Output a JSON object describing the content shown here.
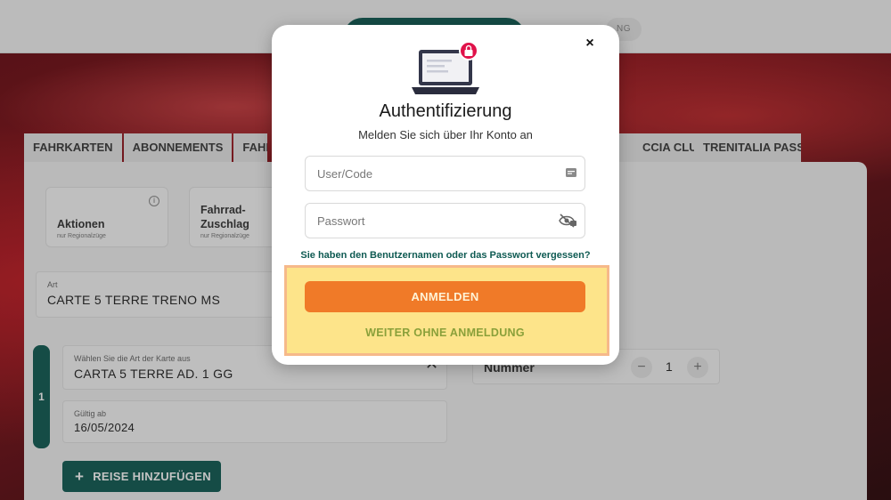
{
  "topbar": {
    "language_label": "NG"
  },
  "tabs": [
    "FAHRKARTEN",
    "ABONNEMENTS",
    "FAHR",
    "",
    "",
    "",
    "CCIA CLUB",
    "TRENITALIA PASS"
  ],
  "promos": [
    {
      "title": "Aktionen",
      "subtitle": "nur Regionalzüge",
      "info": "i"
    },
    {
      "title_line1": "Fahrrad-",
      "title_line2": "Zuschlag",
      "subtitle": "nur Regionalzüge"
    }
  ],
  "art_field": {
    "label": "Art",
    "value": "CARTE 5 TERRE TRENO MS"
  },
  "trip": {
    "index": "1",
    "card_type": {
      "label": "Wählen Sie die Art der Karte aus",
      "value": "CARTA 5 TERRE AD. 1 GG"
    },
    "valid_from": {
      "label": "Gültig ab",
      "value": "16/05/2024"
    },
    "number": {
      "label": "Nummer",
      "value": "1",
      "minus": "−",
      "plus": "+"
    }
  },
  "add_trip": {
    "icon": "+",
    "label": "REISE HINZUFÜGEN"
  },
  "modal": {
    "close": "×",
    "title": "Authentifizierung",
    "subtitle": "Melden Sie sich über Ihr Konto an",
    "user_placeholder": "User/Code",
    "password_placeholder": "Passwort",
    "forgot_link": "Sie haben den Benutzernamen oder das Passwort vergessen?",
    "login_button": "ANMELDEN",
    "guest_button": "WEITER OHNE ANMELDUNG"
  },
  "colors": {
    "brand_green": "#0e5a52",
    "login_orange": "#f07a28",
    "highlight_yellow": "#fde48a",
    "lock_badge": "#e0124a"
  },
  "icons": [
    "laptop-lock-icon",
    "id-card-icon",
    "eye-off-icon",
    "close-icon",
    "info-icon",
    "plus-icon"
  ]
}
